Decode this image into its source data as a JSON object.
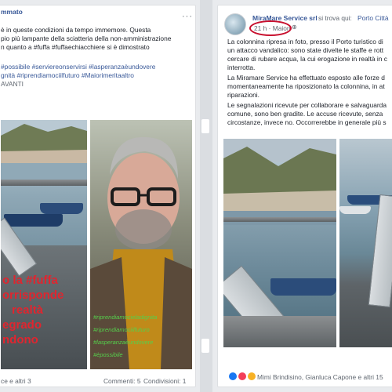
{
  "left_post": {
    "author": "mmato",
    "text_lines": [
      "è in queste condizioni da tempo immemore. Questa",
      "pio più lampante della sciatteria della non-amministrazione",
      "n quanto a #fuffa #fuffaechiacchiere si è dimostrato"
    ],
    "hashtag_lines": [
      "#possibile #serviereonservirsi #lasperanzaèundovere",
      "gnità #riprendiamociilfuturo #Maiorimeritaaltro"
    ],
    "see_more": "AVANTI",
    "overlay_lines": [
      "o la #fuffa",
      "orrisponde",
      "realtà",
      "egrado",
      "ndono"
    ],
    "tag_overlay_lines": [
      "#riprendiamocieladignita",
      "#riprendiamociilfuturo",
      "#lasperanzaèundovere",
      "#èpossibile"
    ],
    "reactions_text": "ce e altri 3",
    "comments": "Commenti: 5",
    "shares": "Condivisioni: 1"
  },
  "right_post": {
    "author": "MiraMare Service srl",
    "location_prefix": "si trova qui:",
    "location": "Porto Città",
    "timestamp": "21 h · Maiori",
    "text_lines": [
      "La colonnina ripresa in foto, presso il Porto turistico di",
      "un attacco vandalico: sono state divelte le staffe e rott",
      "cercare di rubare acqua, la cui erogazione in realtà in c",
      "interrotta.",
      "La Miramare Service ha effettuato esposto alle forze d",
      "momentaneamente ha riposizionato la colonnina, in at",
      "riparazioni.",
      "Le segnalazioni ricevute per collaborare e salvaguarda",
      "comune, sono ben gradite. Le accuse ricevute, senza",
      "circostanze, invece no. Occorrerebbe in generale più s"
    ],
    "reactions_text": "Mimi Brindisino, Gianluca Capone e altri 15"
  }
}
